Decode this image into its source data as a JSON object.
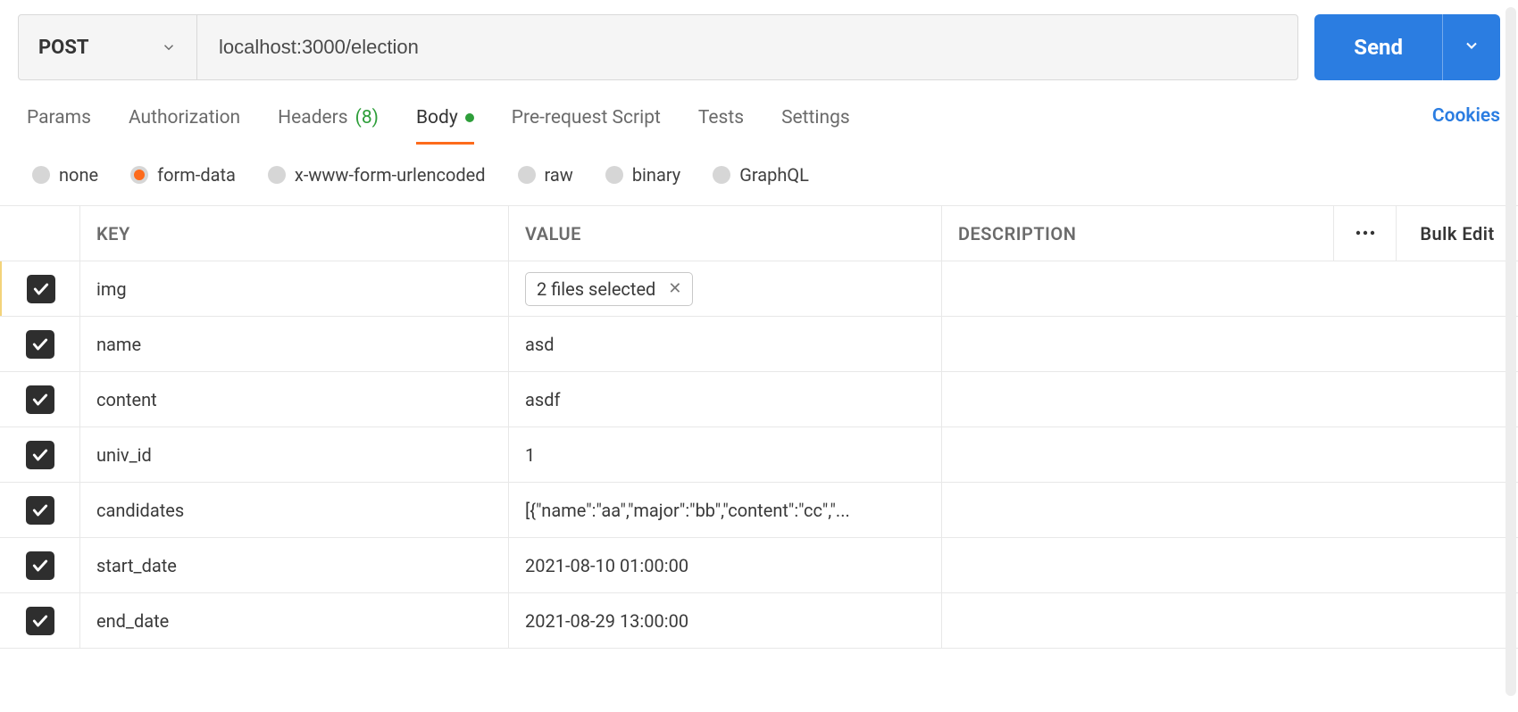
{
  "request": {
    "method": "POST",
    "url": "localhost:3000/election",
    "send_label": "Send"
  },
  "tabs": {
    "params": "Params",
    "authorization": "Authorization",
    "headers_label": "Headers",
    "headers_count": "(8)",
    "body": "Body",
    "prerequest": "Pre-request Script",
    "tests": "Tests",
    "settings": "Settings",
    "cookies": "Cookies"
  },
  "body_types": {
    "none": "none",
    "form_data": "form-data",
    "urlencoded": "x-www-form-urlencoded",
    "raw": "raw",
    "binary": "binary",
    "graphql": "GraphQL"
  },
  "table": {
    "head_key": "KEY",
    "head_value": "VALUE",
    "head_desc": "DESCRIPTION",
    "more": "•••",
    "bulk_edit": "Bulk Edit",
    "rows": [
      {
        "key": "img",
        "value_type": "file",
        "value": "2 files selected",
        "desc": ""
      },
      {
        "key": "name",
        "value_type": "text",
        "value": "asd",
        "desc": ""
      },
      {
        "key": "content",
        "value_type": "text",
        "value": "asdf",
        "desc": ""
      },
      {
        "key": "univ_id",
        "value_type": "text",
        "value": "1",
        "desc": ""
      },
      {
        "key": "candidates",
        "value_type": "text",
        "value": "[{\"name\":\"aa\",\"major\":\"bb\",\"content\":\"cc\",\"...",
        "desc": ""
      },
      {
        "key": "start_date",
        "value_type": "text",
        "value": "2021-08-10 01:00:00",
        "desc": ""
      },
      {
        "key": "end_date",
        "value_type": "text",
        "value": "2021-08-29 13:00:00",
        "desc": ""
      }
    ]
  }
}
